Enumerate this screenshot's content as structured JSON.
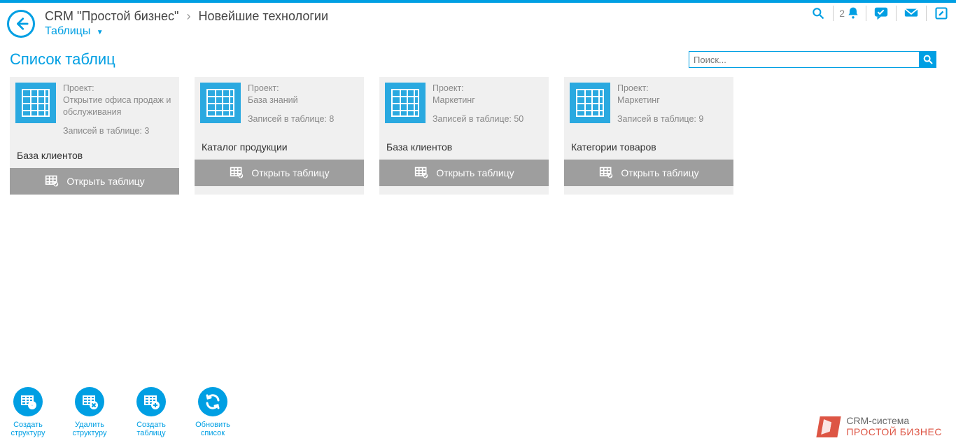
{
  "header": {
    "breadcrumb_root": "CRM \"Простой бизнес\"",
    "breadcrumb_current": "Новейшие технологии",
    "dropdown_label": "Таблицы",
    "tools": {
      "notif_count": "2"
    }
  },
  "page": {
    "title": "Список таблиц",
    "search_placeholder": "Поиск..."
  },
  "labels": {
    "project_label": "Проект:",
    "records_prefix": "Записей в таблице: ",
    "open_table": "Открыть таблицу"
  },
  "cards": [
    {
      "project": "Открытие офиса продаж и обслуживания",
      "records": "3",
      "name": "База клиентов"
    },
    {
      "project": "База знаний",
      "records": "8",
      "name": "Каталог продукции"
    },
    {
      "project": "Маркетинг",
      "records": "50",
      "name": "База клиентов"
    },
    {
      "project": "Маркетинг",
      "records": "9",
      "name": "Категории товаров"
    }
  ],
  "footer": {
    "actions": [
      {
        "label": "Создать\nструктуру",
        "icon": "create-structure"
      },
      {
        "label": "Удалить\nструктуру",
        "icon": "delete-structure"
      },
      {
        "label": "Создать\nтаблицу",
        "icon": "create-table"
      },
      {
        "label": "Обновить\nсписок",
        "icon": "refresh-list"
      }
    ],
    "brand_line1": "CRM-система",
    "brand_line2": "ПРОСТОЙ БИЗНЕС"
  }
}
